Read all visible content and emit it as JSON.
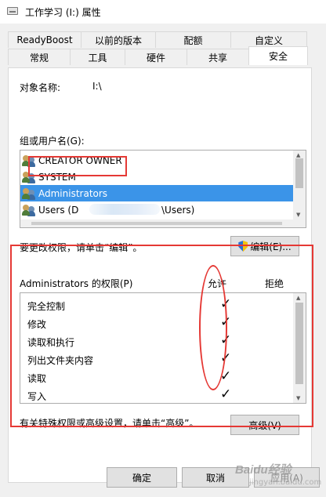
{
  "window": {
    "title": "工作学习 (I:) 属性"
  },
  "tabs": {
    "row1": [
      "ReadyBoost",
      "以前的版本",
      "配额",
      "自定义"
    ],
    "row2": [
      "常规",
      "工具",
      "硬件",
      "共享",
      "安全"
    ],
    "active": "安全"
  },
  "security": {
    "object_label": "对象名称:",
    "object_value": "I:\\",
    "group_label": "组或用户名(G):",
    "users": [
      {
        "name": "CREATOR OWNER"
      },
      {
        "name": "SYSTEM"
      },
      {
        "name": "Administrators"
      },
      {
        "name": "Users (D",
        "suffix": "\\Users)"
      }
    ],
    "selected_user": "Administrators",
    "change_hint": "要更改权限，请单击“编辑”。",
    "edit_button": "编辑(E)...",
    "permissions_title": "Administrators 的权限(P)",
    "allow_header": "允许",
    "deny_header": "拒绝",
    "permissions": [
      {
        "name": "完全控制",
        "allow": "✓"
      },
      {
        "name": "修改",
        "allow": "✓"
      },
      {
        "name": "读取和执行",
        "allow": "✓"
      },
      {
        "name": "列出文件夹内容",
        "allow": "✓"
      },
      {
        "name": "读取",
        "allow": "✓"
      },
      {
        "name": "写入",
        "allow": "✓"
      }
    ],
    "advanced_hint": "有关特殊权限或高级设置，请单击“高级”。",
    "advanced_button": "高级(V)"
  },
  "footer": {
    "ok": "确定",
    "cancel": "取消",
    "apply": "应用(A)"
  },
  "watermark": {
    "text": "Baidu经验",
    "sub": "jingyan.baidu.com"
  },
  "colors": {
    "selection": "#3b94e8",
    "annotation": "#e53935"
  }
}
